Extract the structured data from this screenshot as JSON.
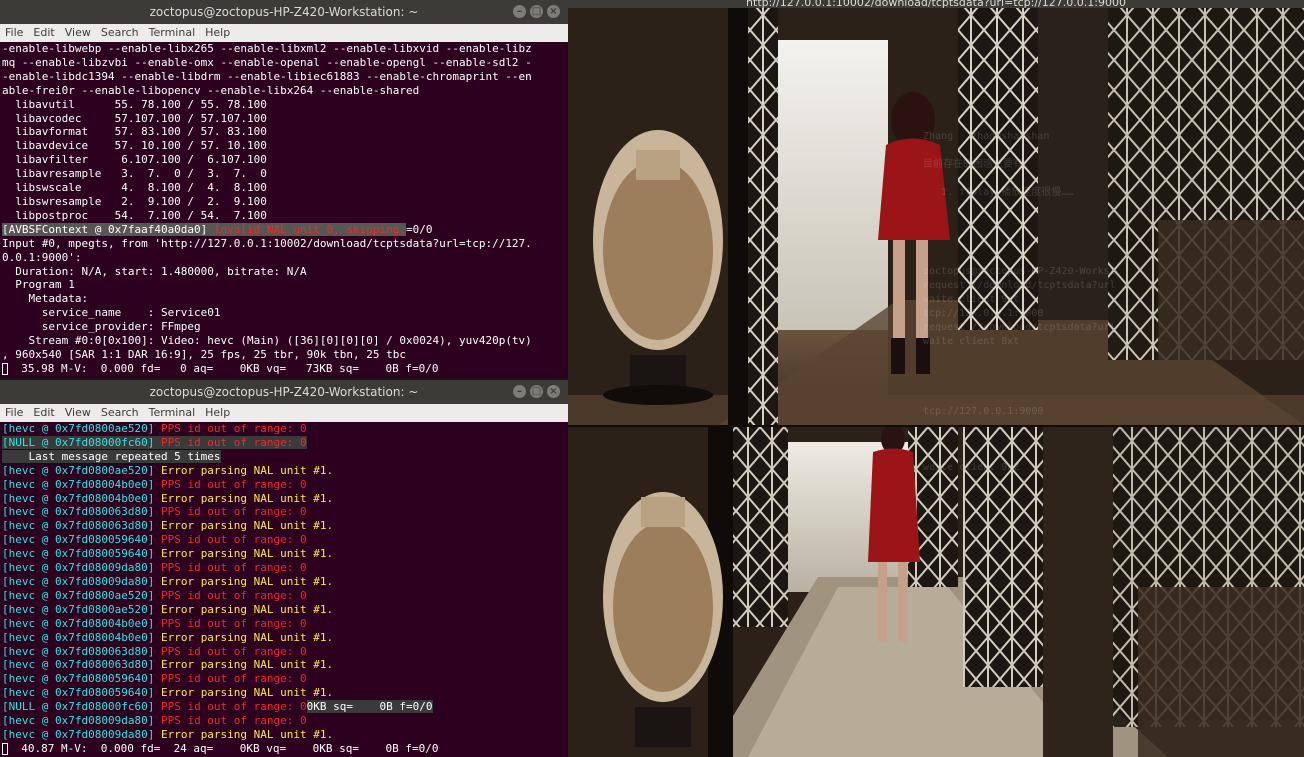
{
  "terminal_top": {
    "title": "zoctopus@zoctopus-HP-Z420-Workstation: ~",
    "menu": [
      "File",
      "Edit",
      "View",
      "Search",
      "Terminal",
      "Help"
    ],
    "lines": [
      "-enable-libwebp --enable-libx265 --enable-libxml2 --enable-libxvid --enable-libz",
      "mq --enable-libzvbi --enable-omx --enable-openal --enable-opengl --enable-sdl2 -",
      "-enable-libdc1394 --enable-libdrm --enable-libiec61883 --enable-chromaprint --en",
      "able-frei0r --enable-libopencv --enable-libx264 --enable-shared",
      "  libavutil      55. 78.100 / 55. 78.100",
      "  libavcodec     57.107.100 / 57.107.100",
      "  libavformat    57. 83.100 / 57. 83.100",
      "  libavdevice    57. 10.100 / 57. 10.100",
      "  libavfilter     6.107.100 /  6.107.100",
      "  libavresample   3.  7.  0 /  3.  7.  0",
      "  libswscale      4.  8.100 /  4.  8.100",
      "  libswresample   2.  9.100 /  2.  9.100",
      "  libpostproc    54.  7.100 / 54.  7.100"
    ],
    "avbsf_prefix": "[AVBSFContext @ 0x7faaf40a0da0] ",
    "avbsf_msg": "Invalid NAL unit 0, skipping.",
    "avbsf_tail": "=0/0",
    "lines2": [
      "Input #0, mpegts, from 'http://127.0.0.1:10002/download/tcptsdata?url=tcp://127.",
      "0.0.1:9000':",
      "  Duration: N/A, start: 1.480000, bitrate: N/A",
      "  Program 1",
      "    Metadata:",
      "      service_name    : Service01",
      "      service_provider: FFmpeg",
      "    Stream #0:0[0x100]: Video: hevc (Main) ([36][0][0][0] / 0x0024), yuv420p(tv)",
      ", 960x540 [SAR 1:1 DAR 16:9], 25 fps, 25 tbr, 90k tbn, 25 tbc"
    ],
    "status": "  35.98 M-V:  0.000 fd=   0 aq=    0KB vq=   73KB sq=    0B f=0/0"
  },
  "terminal_bottom": {
    "title": "zoctopus@zoctopus-HP-Z420-Workstation: ~",
    "menu": [
      "File",
      "Edit",
      "View",
      "Search",
      "Terminal",
      "Help"
    ],
    "lines": [
      {
        "p": "[hevc @ 0x7fd0800ae520] ",
        "m": "PPS id out of range: 0",
        "c": "red"
      },
      {
        "p": "[NULL @ 0x7fd08000fc60] ",
        "m": "PPS id out of range: 0",
        "c": "red"
      },
      {
        "p": "    Last message repeated 5 times",
        "m": "",
        "c": "white"
      },
      {
        "p": "[hevc @ 0x7fd0800ae520] ",
        "m": "Error parsing NAL unit #1.",
        "c": "yellow"
      },
      {
        "p": "[hevc @ 0x7fd08004b0e0] ",
        "m": "PPS id out of range: 0",
        "c": "red"
      },
      {
        "p": "[hevc @ 0x7fd08004b0e0] ",
        "m": "Error parsing NAL unit #1.",
        "c": "yellow"
      },
      {
        "p": "[hevc @ 0x7fd080063d80] ",
        "m": "PPS id out of range: 0",
        "c": "red"
      },
      {
        "p": "[hevc @ 0x7fd080063d80] ",
        "m": "Error parsing NAL unit #1.",
        "c": "yellow"
      },
      {
        "p": "[hevc @ 0x7fd080059640] ",
        "m": "PPS id out of range: 0",
        "c": "red"
      },
      {
        "p": "[hevc @ 0x7fd080059640] ",
        "m": "Error parsing NAL unit #1.",
        "c": "yellow"
      },
      {
        "p": "[hevc @ 0x7fd08009da80] ",
        "m": "PPS id out of range: 0",
        "c": "red"
      },
      {
        "p": "[hevc @ 0x7fd08009da80] ",
        "m": "Error parsing NAL unit #1.",
        "c": "yellow"
      },
      {
        "p": "[hevc @ 0x7fd0800ae520] ",
        "m": "PPS id out of range: 0",
        "c": "red"
      },
      {
        "p": "[hevc @ 0x7fd0800ae520] ",
        "m": "Error parsing NAL unit #1.",
        "c": "yellow"
      },
      {
        "p": "[hevc @ 0x7fd08004b0e0] ",
        "m": "PPS id out of range: 0",
        "c": "red"
      },
      {
        "p": "[hevc @ 0x7fd08004b0e0] ",
        "m": "Error parsing NAL unit #1.",
        "c": "yellow"
      },
      {
        "p": "[hevc @ 0x7fd080063d80] ",
        "m": "PPS id out of range: 0",
        "c": "red"
      },
      {
        "p": "[hevc @ 0x7fd080063d80] ",
        "m": "Error parsing NAL unit #1.",
        "c": "yellow"
      },
      {
        "p": "[hevc @ 0x7fd080059640] ",
        "m": "PPS id out of range: 0",
        "c": "red"
      },
      {
        "p": "[hevc @ 0x7fd080059640] ",
        "m": "Error parsing NAL unit #1.",
        "c": "yellow"
      },
      {
        "p": "[NULL @ 0x7fd08000fc60] ",
        "m": "PPS id out of range: 0",
        "c": "red",
        "t": "0KB sq=    0B f=0/0"
      },
      {
        "p": "[hevc @ 0x7fd08009da80] ",
        "m": "PPS id out of range: 0",
        "c": "red"
      },
      {
        "p": "[hevc @ 0x7fd08009da80] ",
        "m": "Error parsing NAL unit #1.",
        "c": "yellow"
      }
    ],
    "status": "  40.87 M-V:  0.000 fd=  24 aq=    0KB vq=    0KB sq=    0B f=0/0"
  },
  "viewer": {
    "title": "http://127.0.0.1:10002/download/tcptsdata?url=tcp://127.0.0.1:9000",
    "ghost_text_1": "Zhang · zhangshanshan\n\n目前存在的困惑主要有\n\n   1. ffplay 播放速度很慢……",
    "ghost_text_2": "zoctopus@zoctopus-HP-Z420-Workst\nrequest //download/tcptsdata?url\nwaite client 9xt\ntcp://127.0.0.1:9000\nrequest //download/tcptsdata?url\nwaite client 8xt\n\n\n\n\ntcp://127.0.0.1:9000\n\n\n\nwaite client 9a2"
  },
  "colors": {
    "terminal_bg": "#2c001e",
    "error_red": "#ef2929",
    "hevc_cyan": "#34e2e2",
    "warn_yellow": "#fce94f"
  }
}
